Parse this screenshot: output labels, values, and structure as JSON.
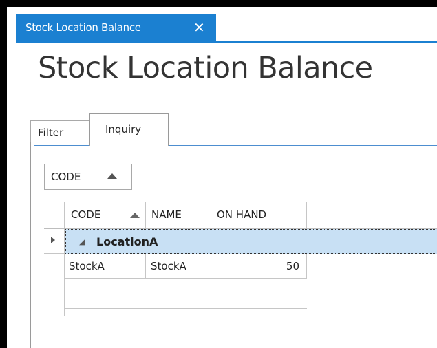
{
  "document_tab": {
    "label": "Stock Location Balance",
    "close_symbol": "✕"
  },
  "page": {
    "title": "Stock Location Balance"
  },
  "tabs": [
    {
      "label": "Filter"
    },
    {
      "label": "Inquiry"
    }
  ],
  "group_panel": {
    "label": "CODE"
  },
  "grid": {
    "columns": [
      {
        "label": "CODE"
      },
      {
        "label": "NAME"
      },
      {
        "label": "ON HAND"
      }
    ],
    "group": {
      "label": "LocationA"
    },
    "rows": [
      {
        "code": "StockA",
        "name": "StockA",
        "on_hand": "50"
      }
    ]
  },
  "colors": {
    "accent": "#1b80d1",
    "group_row_bg": "#c8e0f4",
    "background": "#ffffff"
  }
}
